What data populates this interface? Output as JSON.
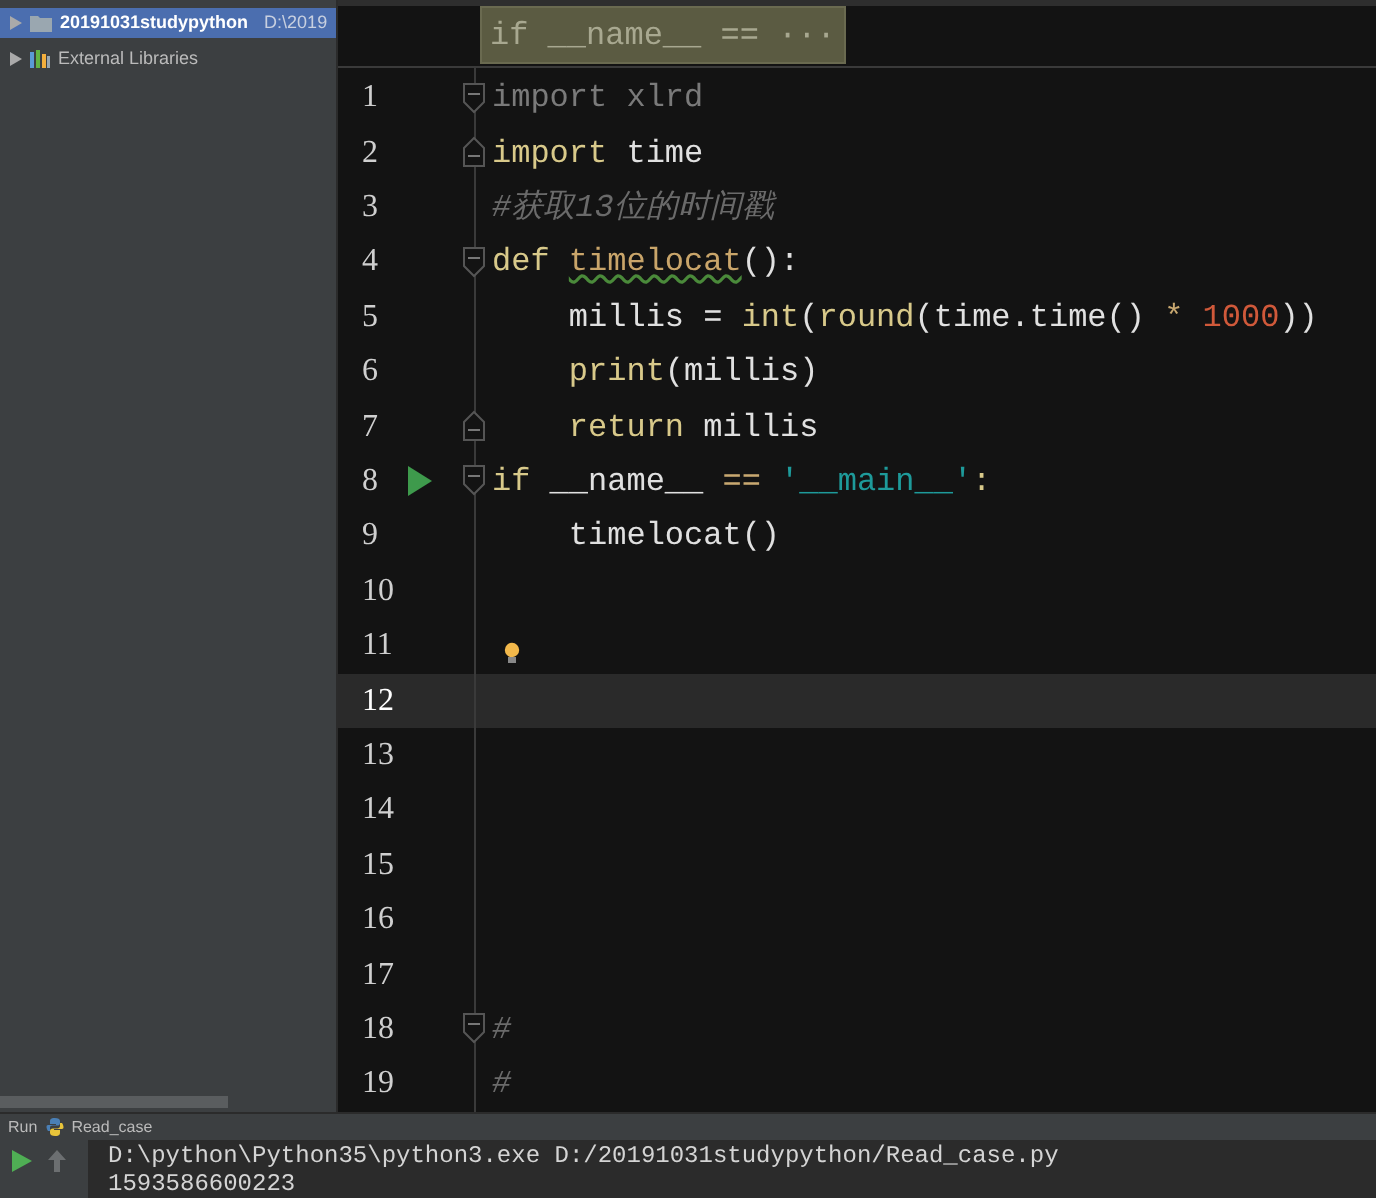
{
  "sidebar": {
    "items": [
      {
        "kind": "project",
        "name": "20191031studypython",
        "path": "D:\\2019",
        "selected": true
      },
      {
        "kind": "libraries",
        "name": "External Libraries",
        "selected": false
      }
    ]
  },
  "editor": {
    "breadcrumb": "if __name__ == ···",
    "lines": [
      {
        "number": "1",
        "fold_start": true,
        "fold_end": false,
        "run": false,
        "hint": false,
        "current": false,
        "tokens": [
          {
            "kind": "unused",
            "text": "import xlrd"
          }
        ]
      },
      {
        "number": "2",
        "fold_start": false,
        "fold_end": true,
        "run": false,
        "hint": false,
        "current": false,
        "tokens": [
          {
            "kind": "keyword",
            "text": "import"
          },
          {
            "kind": "plain",
            "text": " time"
          }
        ]
      },
      {
        "number": "3",
        "fold_start": false,
        "fold_end": false,
        "run": false,
        "hint": false,
        "current": false,
        "tokens": [
          {
            "kind": "comment",
            "text": "#获取13位的时间戳"
          }
        ]
      },
      {
        "number": "4",
        "fold_start": true,
        "fold_end": false,
        "run": false,
        "hint": false,
        "current": false,
        "tokens": [
          {
            "kind": "keyword",
            "text": "def "
          },
          {
            "kind": "func",
            "text": "timelocat"
          },
          {
            "kind": "plain",
            "text": "():"
          }
        ]
      },
      {
        "number": "5",
        "fold_start": false,
        "fold_end": false,
        "run": false,
        "hint": false,
        "current": false,
        "tokens": [
          {
            "kind": "plain",
            "text": "    millis = "
          },
          {
            "kind": "builtin",
            "text": "int"
          },
          {
            "kind": "plain",
            "text": "("
          },
          {
            "kind": "builtin",
            "text": "round"
          },
          {
            "kind": "plain",
            "text": "(time.time() "
          },
          {
            "kind": "operator",
            "text": "* "
          },
          {
            "kind": "number",
            "text": "1000"
          },
          {
            "kind": "plain",
            "text": "))"
          }
        ]
      },
      {
        "number": "6",
        "fold_start": false,
        "fold_end": false,
        "run": false,
        "hint": false,
        "current": false,
        "tokens": [
          {
            "kind": "builtin",
            "text": "    print"
          },
          {
            "kind": "plain",
            "text": "(millis)"
          }
        ]
      },
      {
        "number": "7",
        "fold_start": false,
        "fold_end": true,
        "run": false,
        "hint": false,
        "current": false,
        "tokens": [
          {
            "kind": "keyword",
            "text": "    return"
          },
          {
            "kind": "plain",
            "text": " millis"
          }
        ]
      },
      {
        "number": "8",
        "fold_start": true,
        "fold_end": false,
        "run": true,
        "hint": false,
        "current": false,
        "tokens": [
          {
            "kind": "keyword",
            "text": "if"
          },
          {
            "kind": "plain",
            "text": " __name__ "
          },
          {
            "kind": "operator",
            "text": "== "
          },
          {
            "kind": "string",
            "text": "'__main__'"
          },
          {
            "kind": "keyword",
            "text": ":"
          }
        ]
      },
      {
        "number": "9",
        "fold_start": false,
        "fold_end": false,
        "run": false,
        "hint": false,
        "current": false,
        "tokens": [
          {
            "kind": "plain",
            "text": "    timelocat()"
          }
        ]
      },
      {
        "number": "10",
        "fold_start": false,
        "fold_end": false,
        "run": false,
        "hint": false,
        "current": false
      },
      {
        "number": "11",
        "fold_start": false,
        "fold_end": false,
        "run": false,
        "hint": true,
        "current": false
      },
      {
        "number": "12",
        "fold_start": false,
        "fold_end": false,
        "run": false,
        "hint": false,
        "current": true
      },
      {
        "number": "13",
        "fold_start": false,
        "fold_end": false,
        "run": false,
        "hint": false,
        "current": false
      },
      {
        "number": "14",
        "fold_start": false,
        "fold_end": false,
        "run": false,
        "hint": false,
        "current": false
      },
      {
        "number": "15",
        "fold_start": false,
        "fold_end": false,
        "run": false,
        "hint": false,
        "current": false
      },
      {
        "number": "16",
        "fold_start": false,
        "fold_end": false,
        "run": false,
        "hint": false,
        "current": false
      },
      {
        "number": "17",
        "fold_start": false,
        "fold_end": false,
        "run": false,
        "hint": false,
        "current": false
      },
      {
        "number": "18",
        "fold_start": true,
        "fold_end": false,
        "run": false,
        "hint": false,
        "current": false,
        "tokens": [
          {
            "kind": "comment",
            "text": "#"
          }
        ]
      },
      {
        "number": "19",
        "fold_start": false,
        "fold_end": false,
        "run": false,
        "hint": false,
        "current": false,
        "tokens": [
          {
            "kind": "comment",
            "text": "#"
          }
        ]
      }
    ]
  },
  "run_panel": {
    "label": "Run",
    "config": "Read_case",
    "console": [
      "D:\\python\\Python35\\python3.exe D:/20191031studypython/Read_case.py",
      "1593586600223"
    ]
  }
}
